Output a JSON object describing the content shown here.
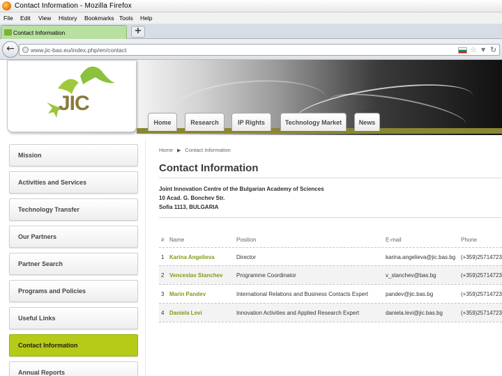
{
  "browser": {
    "window_title": "Contact Information - Mozilla Firefox",
    "menu": [
      "File",
      "Edit",
      "View",
      "History",
      "Bookmarks",
      "Tools",
      "Help"
    ],
    "tab_label": "Contact Information",
    "new_tab_label": "+",
    "url": "www.jic-bas.eu/index.php/en/contact"
  },
  "site": {
    "logo_text": "JIC",
    "nav_tabs": [
      "Home",
      "Research",
      "IP Rights",
      "Technology Market",
      "News"
    ],
    "sidebar": [
      "Mission",
      "Activities and Services",
      "Technology Transfer",
      "Our Partners",
      "Partner Search",
      "Programs and Policies",
      "Useful Links",
      "Contact Information",
      "Annual Reports"
    ],
    "active_sidebar_item": "Contact Information"
  },
  "content": {
    "breadcrumb": [
      "Home",
      "Contact Information"
    ],
    "heading": "Contact Information",
    "address": [
      "Joint Innovation Centre of the Bulgarian Academy of Sciences",
      "10 Acad. G. Bonchev Str.",
      "Sofia 1113, BULGARIA"
    ],
    "table": {
      "headers": [
        "#",
        "Name",
        "Position",
        "E-mail",
        "Phone"
      ],
      "rows": [
        [
          "1",
          "Karina Angelieva",
          "Director",
          "karina.angelieva@jic.bas.bg",
          "(+359)25714723"
        ],
        [
          "2",
          "Venceslav Stanchev",
          "Programme Coordinator",
          "v_stanchev@bas.bg",
          "(+359)25714723"
        ],
        [
          "3",
          "Marin Pandev",
          "International Relations and Business Contacts Expert",
          "pandev@jic.bas.bg",
          "(+359)25714723"
        ],
        [
          "4",
          "Daniela Levi",
          "Innovation Activities and Applied Research Expert",
          "daniela.levi@jic.bas.bg",
          "(+359)25714723"
        ]
      ]
    }
  },
  "colors": {
    "accent_green": "#b5cb17",
    "link_green": "#7d9b17",
    "header_strip": "#8a8732"
  }
}
